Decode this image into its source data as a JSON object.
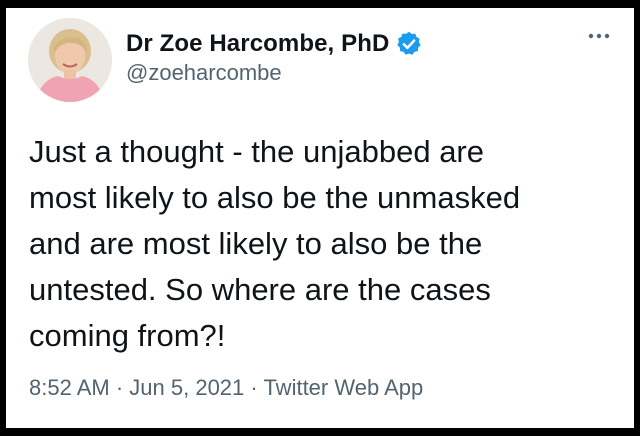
{
  "author": {
    "display_name": "Dr Zoe Harcombe, PhD",
    "handle": "@zoeharcombe",
    "verified": true,
    "avatar_icon": "profile-photo"
  },
  "tweet": {
    "lines": [
      "Just a thought - the unjabbed are",
      "most likely to also be the unmasked",
      "and are most likely to also be the",
      "untested. So where are the cases",
      "coming from?!"
    ]
  },
  "meta": {
    "time": "8:52 AM",
    "separator": "·",
    "date": "Jun 5, 2021",
    "source": "Twitter Web App"
  },
  "colors": {
    "verified_badge": "#1d9bf0",
    "text_primary": "#0f1419",
    "text_secondary": "#536471",
    "background": "#ffffff"
  },
  "icons": {
    "more": "more-horizontal-icon",
    "verified": "verified-badge-icon"
  }
}
